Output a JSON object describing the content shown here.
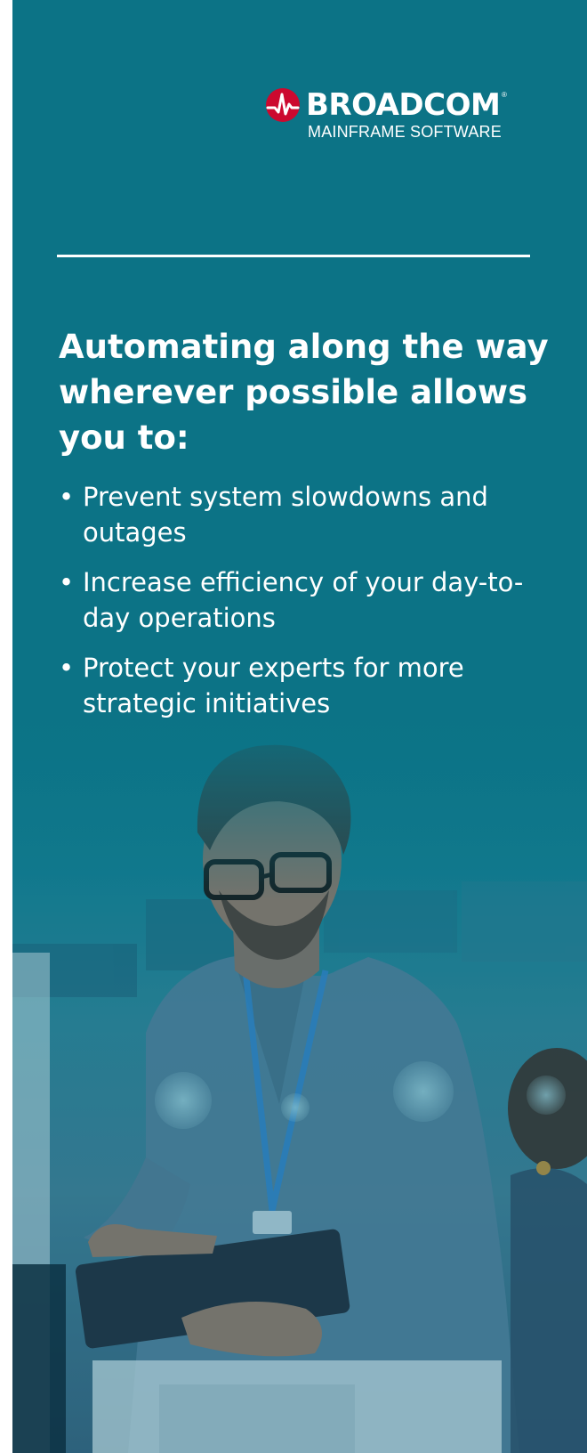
{
  "brand": {
    "name": "BROADCOM",
    "registered": "®",
    "subtitle": "MAINFRAME SOFTWARE",
    "logo_color": "#cc092f"
  },
  "heading": "Automating along the way wherever possible allows you to:",
  "bullets": [
    "Prevent system slowdowns and outages",
    "Increase efficiency of your day-to-day operations",
    "Protect your experts for more strategic initiatives"
  ],
  "bullet_glyph": "•",
  "colors": {
    "background": "#0a7384",
    "text": "#ffffff"
  }
}
